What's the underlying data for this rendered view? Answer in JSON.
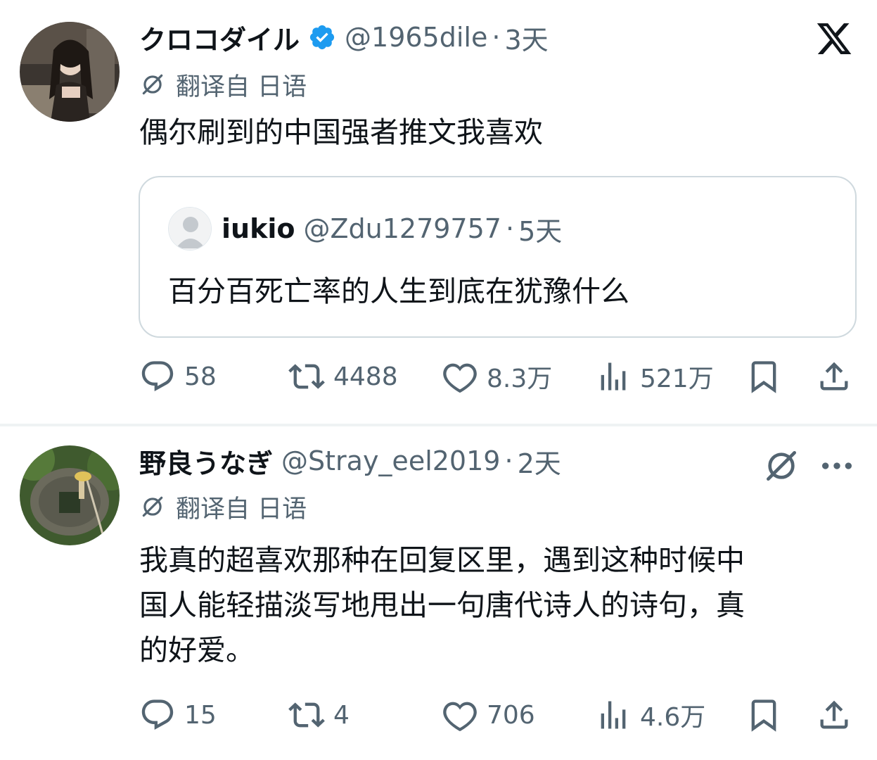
{
  "tweets": [
    {
      "name": "クロコダイル",
      "handle": "@1965dile",
      "separator": "·",
      "time": "3天",
      "verified": true,
      "translated_label": "翻译自 日语",
      "text": "偶尔刷到的中国强者推文我喜欢",
      "quote": {
        "name": "iukio",
        "handle": "@Zdu1279757",
        "separator": "·",
        "time": "5天",
        "text": "百分百死亡率的人生到底在犹豫什么"
      },
      "stats": {
        "replies": "58",
        "retweets": "4488",
        "likes": "8.3万",
        "views": "521万"
      }
    },
    {
      "name": "野良うなぎ",
      "handle": "@Stray_eel2019",
      "separator": "·",
      "time": "2天",
      "verified": false,
      "translated_label": "翻译自 日语",
      "text_lines": [
        "我真的超喜欢那种在回复区里，遇到这种时候中",
        "国人能轻描淡写地甩出一句唐代诗人的诗句，真",
        "的好爱。"
      ],
      "stats": {
        "replies": "15",
        "retweets": "4",
        "likes": "706",
        "views": "4.6万"
      }
    }
  ],
  "colors": {
    "text": "#0f1419",
    "muted": "#536471",
    "verified": "#1d9bf0",
    "border": "#cfd9de"
  },
  "icons": [
    "x-logo-icon",
    "verified-badge-icon",
    "translate-icon",
    "reply-icon",
    "retweet-icon",
    "like-icon",
    "views-icon",
    "bookmark-icon",
    "share-icon",
    "grok-icon",
    "more-icon"
  ]
}
